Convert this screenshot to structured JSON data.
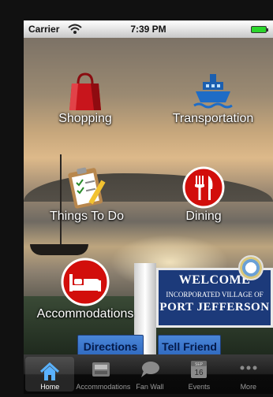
{
  "status_bar": {
    "carrier": "Carrier",
    "time": "7:39 PM"
  },
  "menu": {
    "shopping": "Shopping",
    "transportation": "Transportation",
    "things_to_do": "Things To Do",
    "dining": "Dining",
    "accommodations": "Accommodations"
  },
  "sign": {
    "welcome": "WELCOME",
    "village": "INCORPORATED VILLAGE OF",
    "port": "PORT JEFFERSON"
  },
  "buttons": {
    "directions": "Directions",
    "tell_friend": "Tell Friend"
  },
  "tab_bar": {
    "tabs": [
      {
        "label": "Home",
        "icon": "home-icon",
        "active": true
      },
      {
        "label": "Accommodations",
        "icon": "accommodations-tab-icon",
        "active": false
      },
      {
        "label": "Fan Wall",
        "icon": "chat-bubble-icon",
        "active": false
      },
      {
        "label": "Events",
        "icon": "calendar-icon",
        "active": false,
        "calendar_month": "SEP",
        "calendar_day": "16"
      },
      {
        "label": "More",
        "icon": "more-dots-icon",
        "active": false
      }
    ]
  },
  "colors": {
    "tab_active_icon": "#5ab2ff",
    "button_blue": "#3a78cc",
    "dining_red": "#d20e0b",
    "sign_blue": "#1c3a7a"
  }
}
